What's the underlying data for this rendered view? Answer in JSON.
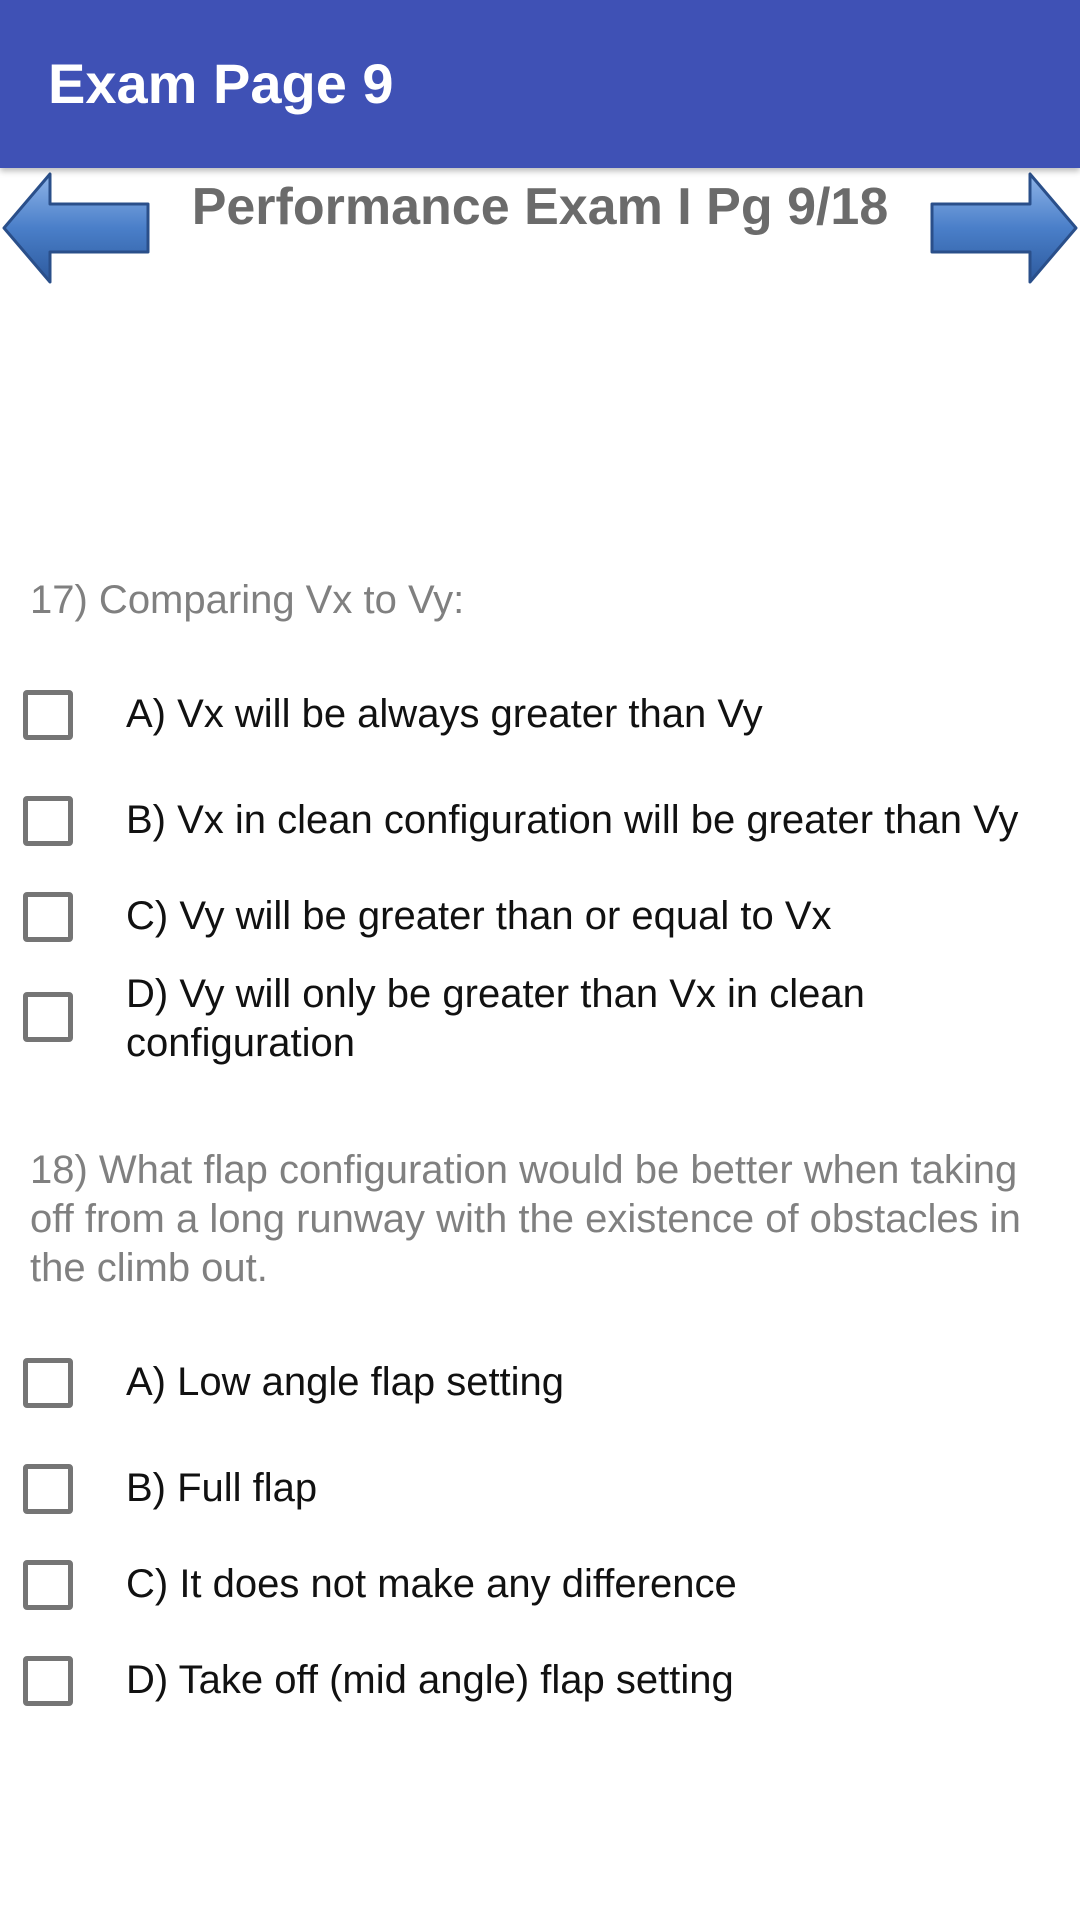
{
  "app_bar": {
    "title": "Exam Page 9"
  },
  "header": {
    "title": "Performance Exam I Pg 9/18"
  },
  "colors": {
    "app_bar": "#3f51b5",
    "arrow": "#4a7fc9",
    "checkbox_border": "#757575",
    "question_text": "#808080"
  },
  "icons": {
    "prev": "arrow-left-icon",
    "next": "arrow-right-icon"
  },
  "questions": [
    {
      "text": "17) Comparing Vx to Vy:",
      "options": [
        "A) Vx will be always greater than Vy",
        "B) Vx in clean configuration will be greater than Vy",
        "C) Vy will be greater than or equal to Vx",
        "D) Vy will only be greater than Vx in clean configuration"
      ]
    },
    {
      "text": "18) What flap configuration would be better when taking off from a long runway with the existence of obstacles in the climb out.",
      "options": [
        "A) Low angle flap setting",
        "B) Full flap",
        "C) It does not make any difference",
        "D) Take off (mid angle) flap setting"
      ]
    }
  ]
}
